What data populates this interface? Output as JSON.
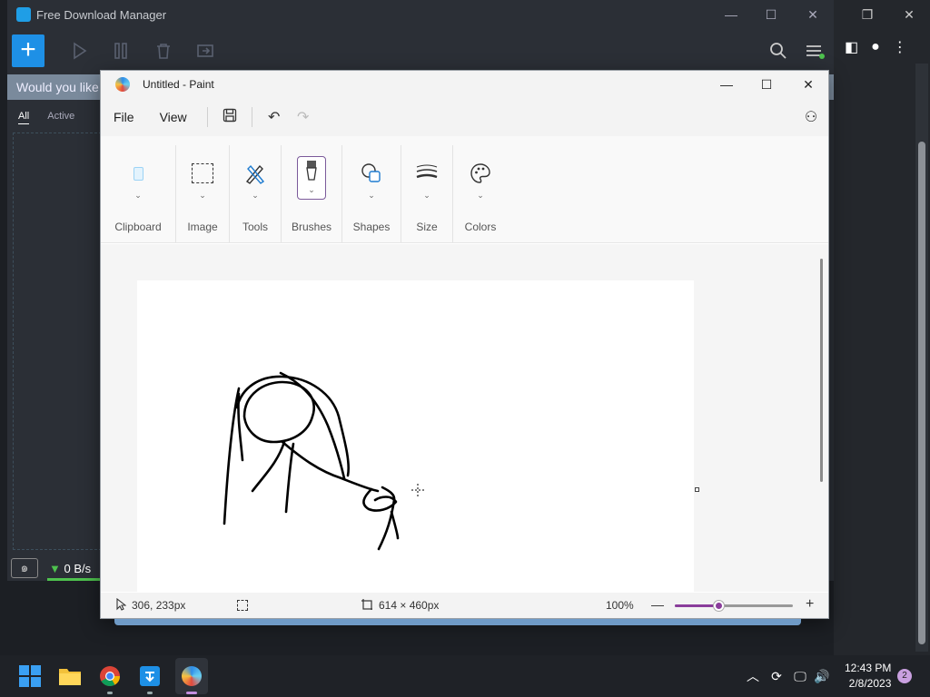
{
  "fdm": {
    "title": "Free Download Manager",
    "banner_text": "Would you like",
    "tabs": [
      "All",
      "Active"
    ],
    "speed": "0 B/s",
    "speed_arrow": "▼"
  },
  "paint": {
    "title": "Untitled - Paint",
    "menu": {
      "file": "File",
      "view": "View"
    },
    "ribbon": {
      "clipboard": "Clipboard",
      "image": "Image",
      "tools": "Tools",
      "brushes": "Brushes",
      "shapes": "Shapes",
      "size": "Size",
      "colors": "Colors"
    },
    "status": {
      "cursor_pos": "306, 233px",
      "canvas_size": "614 × 460px",
      "zoom": "100%"
    },
    "zoom_fraction": 0.38
  },
  "taskbar": {
    "time": "12:43 PM",
    "date": "2/8/2023",
    "notifications": "2"
  },
  "colors": {
    "accent_purple": "#8a3d9b",
    "fdm_blue": "#1e90e6",
    "speed_green": "#4ec24e"
  }
}
